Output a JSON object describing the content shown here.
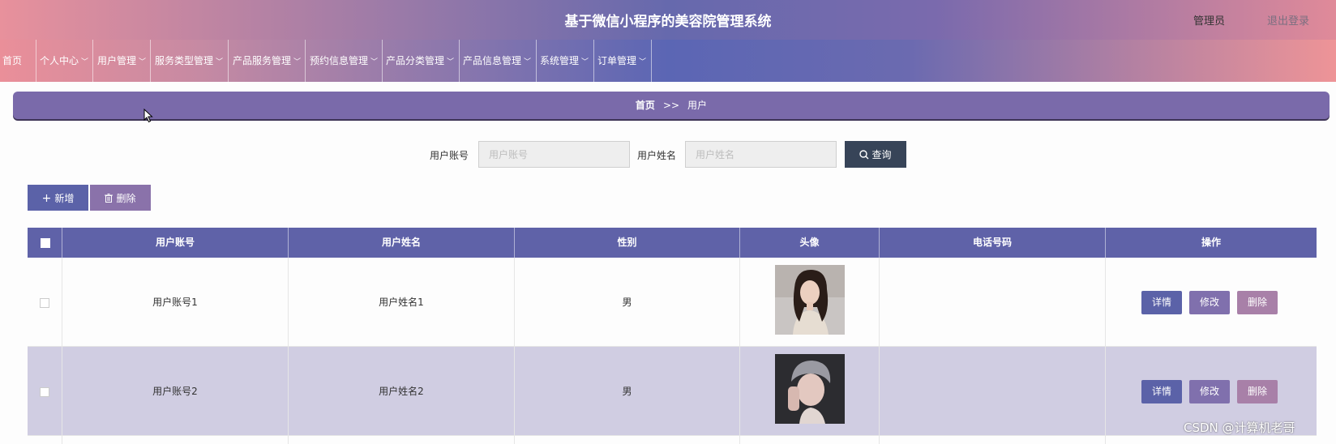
{
  "header": {
    "title": "基于微信小程序的美容院管理系统",
    "admin": "管理员",
    "logout": "退出登录"
  },
  "nav": [
    {
      "label": "首页",
      "dropdown": false
    },
    {
      "label": "个人中心",
      "dropdown": true
    },
    {
      "label": "用户管理",
      "dropdown": true
    },
    {
      "label": "服务类型管理",
      "dropdown": true
    },
    {
      "label": "产品服务管理",
      "dropdown": true
    },
    {
      "label": "预约信息管理",
      "dropdown": true
    },
    {
      "label": "产品分类管理",
      "dropdown": true
    },
    {
      "label": "产品信息管理",
      "dropdown": true
    },
    {
      "label": "系统管理",
      "dropdown": true
    },
    {
      "label": "订单管理",
      "dropdown": true
    }
  ],
  "breadcrumb": {
    "home": "首页",
    "separator": ">>",
    "current": "用户"
  },
  "search": {
    "account_label": "用户账号",
    "account_placeholder": "用户账号",
    "name_label": "用户姓名",
    "name_placeholder": "用户姓名",
    "query_label": "查询"
  },
  "actions": {
    "add_label": "新增",
    "delete_label": "删除"
  },
  "table": {
    "columns": [
      "用户账号",
      "用户姓名",
      "性别",
      "头像",
      "电话号码",
      "操作"
    ],
    "rows": [
      {
        "account": "用户账号1",
        "name": "用户姓名1",
        "gender": "男",
        "phone": ""
      },
      {
        "account": "用户账号2",
        "name": "用户姓名2",
        "gender": "男",
        "phone": ""
      }
    ],
    "row_buttons": {
      "detail": "详情",
      "edit": "修改",
      "delete": "删除"
    }
  },
  "watermark": "CSDN @计算机老哥",
  "colors": {
    "header_th": "#5f62a8",
    "detail_btn": "#5b62a8",
    "edit_btn": "#8070ad",
    "delete_btn": "#a880a8",
    "query_btn": "#374458",
    "striped_row": "#d0cde2"
  }
}
